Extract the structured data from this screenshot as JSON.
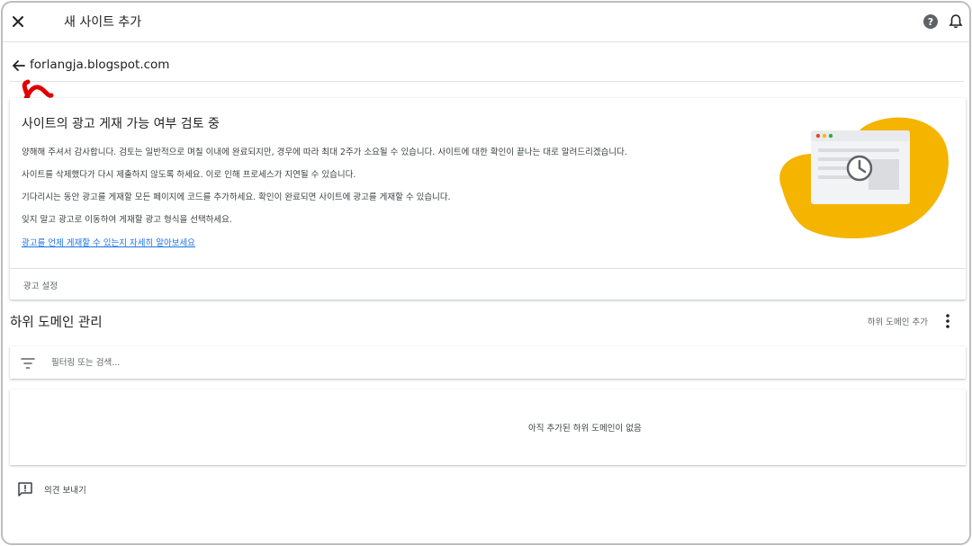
{
  "topbar": {
    "title": "새 사이트 추가",
    "close_icon": "close-icon",
    "help_icon": "help-icon",
    "bell_icon": "notifications-icon"
  },
  "site": {
    "back_icon": "arrow-back-icon",
    "url": "forlangja.blogspot.com"
  },
  "review_card": {
    "title": "사이트의 광고 게재 가능 여부 검토 중",
    "lines": [
      "양해해 주셔서 감사합니다. 검토는 일반적으로 며칠 이내에 완료되지만, 경우에 따라 최대 2주가 소요될 수 있습니다. 사이트에 대한 확인이 끝나는 대로 알려드리겠습니다.",
      "사이트를 삭제했다가 다시 제출하지 않도록 하세요. 이로 인해 프로세스가 지연될 수 있습니다.",
      "기다리시는 동안 광고를 게재할 모든 페이지에 코드를 추가하세요. 확인이 완료되면 사이트에 광고를 게재할 수 있습니다.",
      "잊지 말고 광고로 이동하여 게재할 광고 형식을 선택하세요."
    ],
    "link": "광고를 언제 게재할 수 있는지 자세히 알아보세요",
    "footer_button": "광고 설정",
    "illustration_icon": "review-clock-illustration"
  },
  "subdomains": {
    "title": "하위 도메인 관리",
    "add_button": "하위 도메인 추가",
    "more_icon": "more-vert-icon",
    "filter_icon": "filter-icon",
    "filter_placeholder": "필터링 또는 검색...",
    "empty_message": "아직 추가된 하위 도메인이 없음"
  },
  "feedback": {
    "icon": "feedback-icon",
    "label": "의견 보내기"
  },
  "colors": {
    "accent_yellow": "#F4B400",
    "link_blue": "#1A73E8",
    "annotation_red": "#E00000"
  }
}
